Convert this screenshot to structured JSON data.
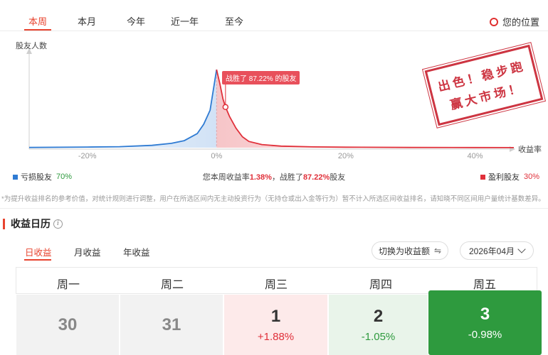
{
  "period_tabs": [
    "本周",
    "本月",
    "今年",
    "近一年",
    "至今"
  ],
  "active_period": 0,
  "my_position_label": "您的位置",
  "chart_data": {
    "type": "area",
    "ylabel": "股友人数",
    "xlabel": "收益率",
    "x_ticks": [
      "-20%",
      "0%",
      "20%",
      "40%"
    ],
    "x_tick_values": [
      -20,
      0,
      20,
      40
    ],
    "xlim": [
      -29,
      46
    ],
    "x": [
      -29,
      -20,
      -15,
      -10,
      -7,
      -5,
      -3,
      -2,
      -1,
      0,
      0.5,
      1,
      1.38,
      2,
      3,
      4,
      5,
      7,
      10,
      15,
      20,
      30,
      40,
      46
    ],
    "y": [
      0.3,
      0.8,
      1.3,
      3,
      5.5,
      9,
      18,
      30,
      48,
      100,
      82,
      62,
      52,
      40,
      25,
      14,
      8,
      4,
      2,
      1,
      0.6,
      0.3,
      0.2,
      0.1
    ],
    "ylim": [
      0,
      100
    ],
    "loss_color": "#2f7bd3",
    "profit_color": "#e0303a",
    "my_return": 1.38,
    "tooltip": "战胜了 87.22% 的股友"
  },
  "stamp": {
    "line1": "出色！稳步跑",
    "line2": "赢大市场！"
  },
  "legend": {
    "loss_label": "亏损股友",
    "loss_pct": "70%",
    "profit_label": "盈利股友",
    "profit_pct": "30%"
  },
  "summary": {
    "prefix": "您本周收益率",
    "return": "1.38%",
    "mid": "，战胜了",
    "beat": "87.22%",
    "suffix": "股友"
  },
  "note": "*为提升收益排名的参考价值，对统计规则进行调整，用户在所选区间内无主动投资行为（无持仓或出入金等行为）暂不计入所选区间收益排名，请知晓不同区间用户量统计基数差异。",
  "calendar": {
    "title": "收益日历",
    "tabs": [
      "日收益",
      "月收益",
      "年收益"
    ],
    "toggle_label": "切换为收益额",
    "month_label": "2026年04月",
    "weekdays": [
      "周一",
      "周二",
      "周三",
      "周四",
      "周五"
    ],
    "days": [
      {
        "day": "30",
        "pct": ""
      },
      {
        "day": "31",
        "pct": ""
      },
      {
        "day": "1",
        "pct": "+1.88%"
      },
      {
        "day": "2",
        "pct": "-1.05%"
      },
      {
        "day": "3",
        "pct": "-0.98%"
      }
    ]
  }
}
